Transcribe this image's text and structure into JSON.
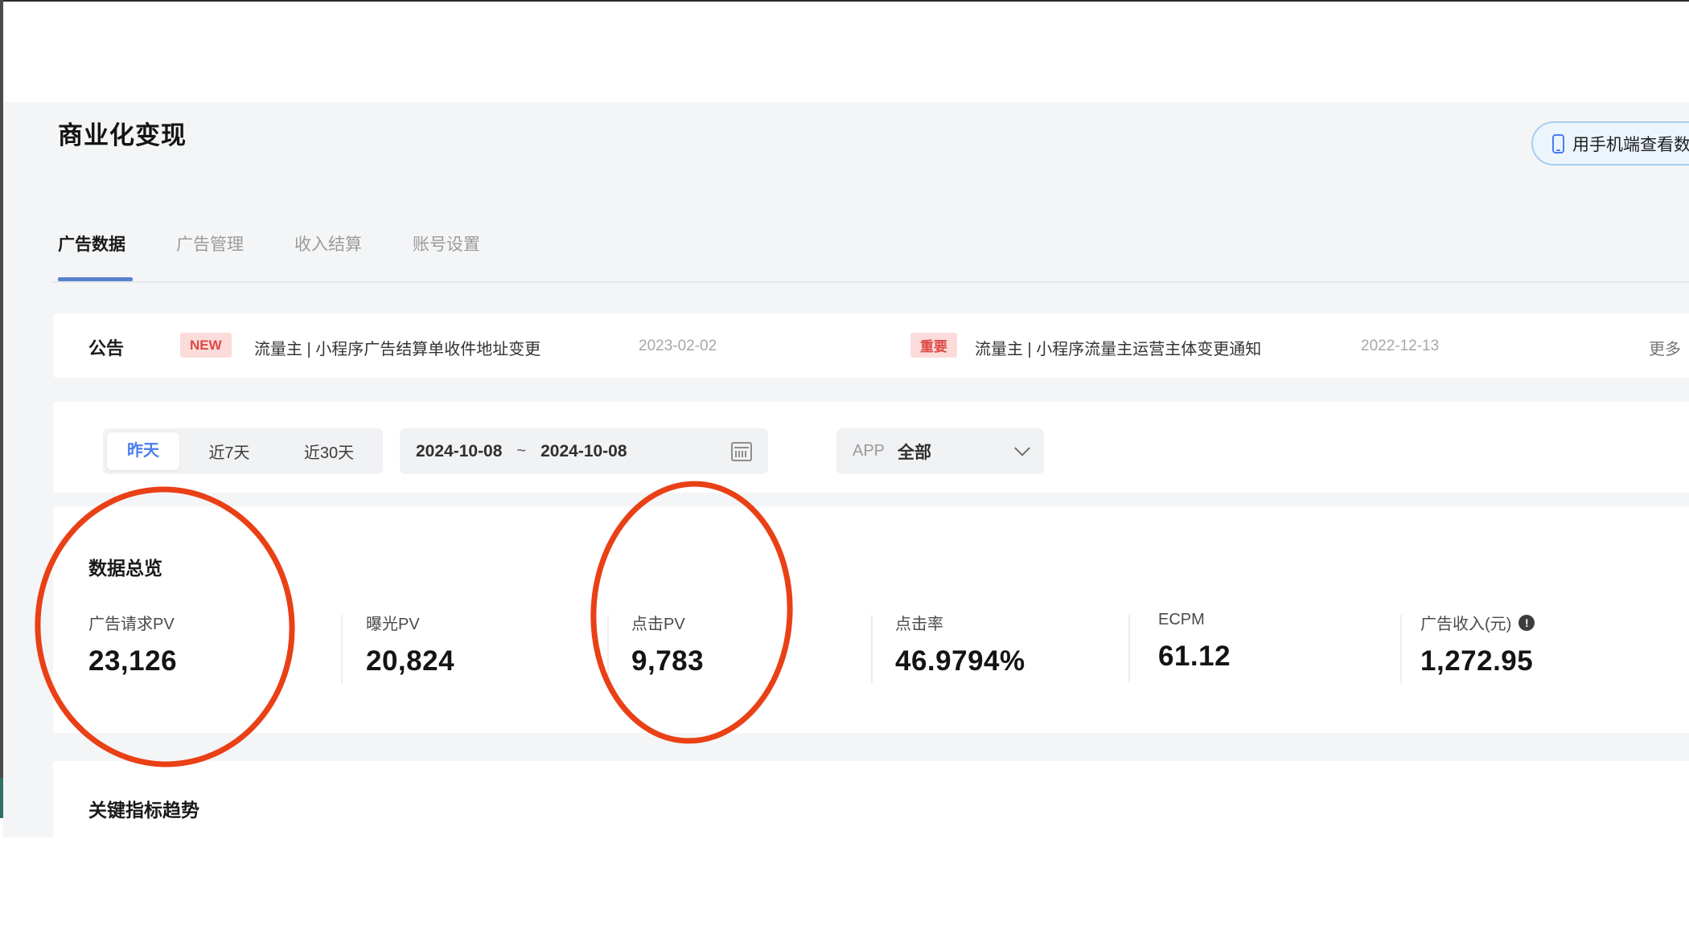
{
  "page": {
    "title": "商业化变现"
  },
  "header": {
    "mobile_button_label": "用手机端查看数据"
  },
  "tabs": [
    {
      "label": "广告数据",
      "active": true
    },
    {
      "label": "广告管理",
      "active": false
    },
    {
      "label": "收入结算",
      "active": false
    },
    {
      "label": "账号设置",
      "active": false
    }
  ],
  "announcement": {
    "title": "公告",
    "more_label": "更多",
    "items": [
      {
        "badge": "NEW",
        "text": "流量主 | 小程序广告结算单收件地址变更",
        "date": "2023-02-02"
      },
      {
        "badge": "重要",
        "text": "流量主 | 小程序流量主运营主体变更通知",
        "date": "2022-12-13"
      }
    ]
  },
  "filters": {
    "quick_ranges": [
      {
        "label": "昨天",
        "selected": true
      },
      {
        "label": "近7天",
        "selected": false
      },
      {
        "label": "近30天",
        "selected": false
      }
    ],
    "date_range": {
      "start": "2024-10-08",
      "separator": "~",
      "end": "2024-10-08"
    },
    "app_filter": {
      "label": "APP",
      "value": "全部"
    }
  },
  "overview": {
    "title": "数据总览",
    "metrics": [
      {
        "label": "广告请求PV",
        "value": "23,126"
      },
      {
        "label": "曝光PV",
        "value": "20,824"
      },
      {
        "label": "点击PV",
        "value": "9,783"
      },
      {
        "label": "点击率",
        "value": "46.9794%"
      },
      {
        "label": "ECPM",
        "value": "61.12"
      },
      {
        "label": "广告收入(元)",
        "value": "1,272.95"
      }
    ]
  },
  "trend": {
    "title": "关键指标趋势"
  },
  "colors": {
    "accent_blue": "#4a7df0",
    "tab_underline": "#5a81cf",
    "badge_bg": "#fbdcda",
    "badge_text": "#dd4a45",
    "annotation_red": "#e8380c",
    "page_bg": "#f4f5f6"
  }
}
